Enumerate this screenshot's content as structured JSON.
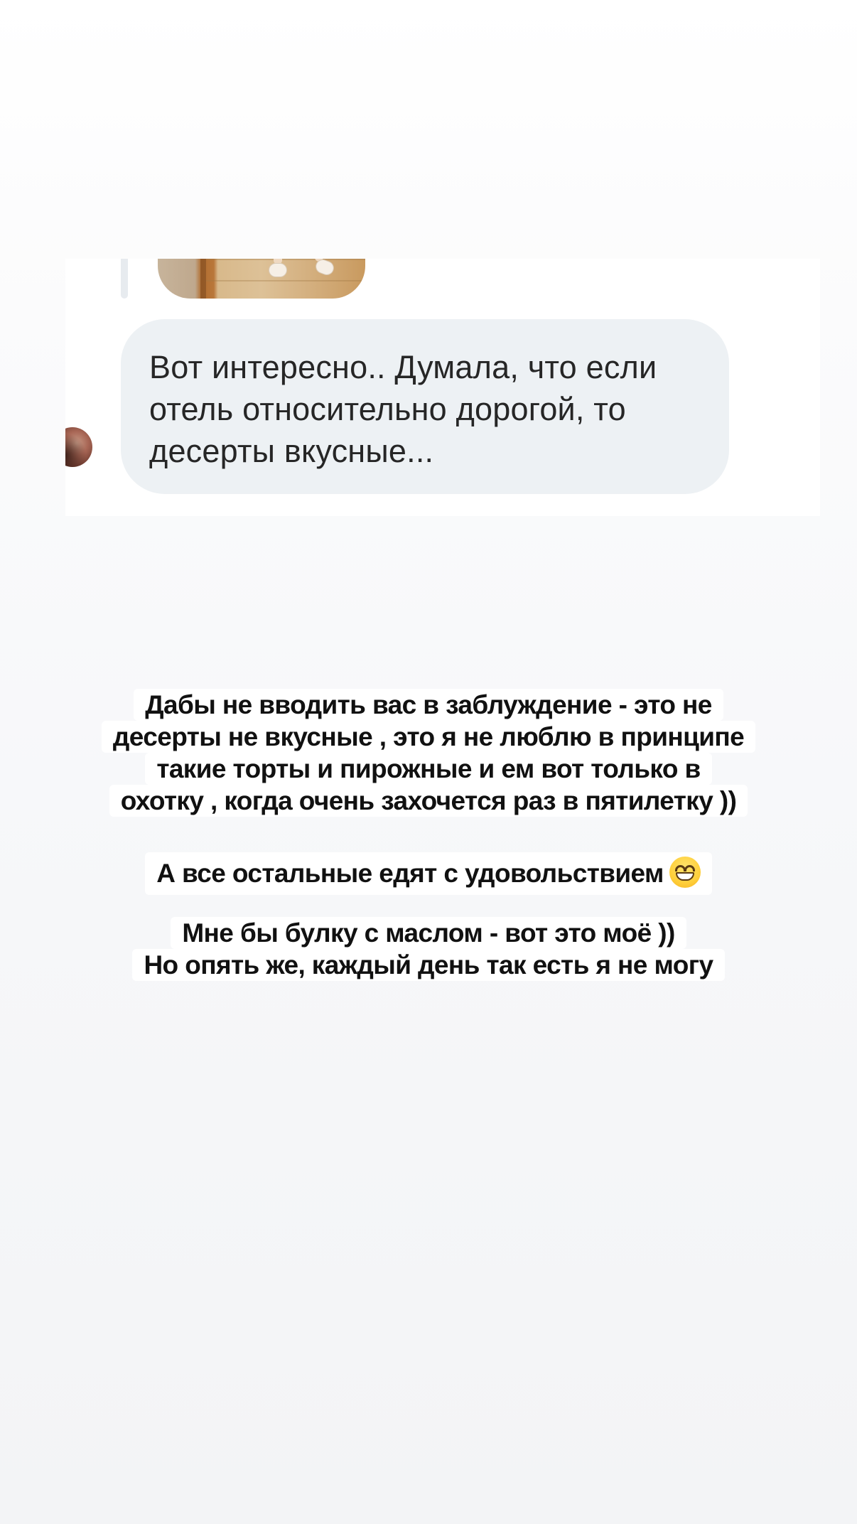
{
  "dm": {
    "message_text": "Вот интересно.. Думала, что если отель относительно дорогой, то десерты вкусные..."
  },
  "captions": {
    "block1": [
      "Дабы не вводить вас в заблуждение - это не",
      "десерты не вкусные , это я не люблю в принципе",
      "такие торты и пирожные и ем вот только в",
      "охотку , когда очень захочется раз в пятилетку ))"
    ],
    "block2": {
      "text": "А все остальные едят с удовольствием",
      "emoji": "grinning-face-emoji"
    },
    "block3": [
      "Мне бы булку с маслом - вот это моё ))",
      "Но опять же, каждый день так есть я не могу"
    ]
  },
  "colors": {
    "bubble": "#edf1f4",
    "text_dark": "#111111",
    "bubble_text": "#262626",
    "highlight": "#ffffff"
  }
}
